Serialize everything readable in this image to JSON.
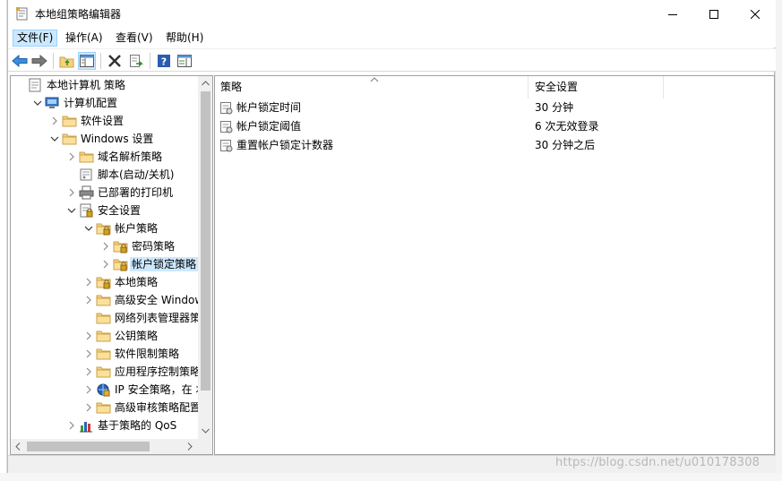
{
  "window": {
    "title": "本地组策略编辑器"
  },
  "menu": [
    {
      "label": "文件(F)"
    },
    {
      "label": "操作(A)"
    },
    {
      "label": "查看(V)"
    },
    {
      "label": "帮助(H)"
    }
  ],
  "tree": [
    {
      "label": "本地计算机 策略",
      "expander": "none",
      "icon": "policy-document-icon"
    },
    {
      "label": "计算机配置",
      "expander": "expanded",
      "icon": "computer-icon"
    },
    {
      "label": "软件设置",
      "expander": "collapsed",
      "icon": "folder-icon"
    },
    {
      "label": "Windows 设置",
      "expander": "expanded",
      "icon": "folder-icon"
    },
    {
      "label": "域名解析策略",
      "expander": "collapsed",
      "icon": "folder-icon"
    },
    {
      "label": "脚本(启动/关机)",
      "expander": "none",
      "icon": "script-icon"
    },
    {
      "label": "已部署的打印机",
      "expander": "collapsed",
      "icon": "printer-icon"
    },
    {
      "label": "安全设置",
      "expander": "expanded",
      "icon": "security-settings-icon"
    },
    {
      "label": "帐户策略",
      "expander": "expanded",
      "icon": "locked-folder-icon"
    },
    {
      "label": "密码策略",
      "expander": "collapsed",
      "icon": "locked-folder-icon"
    },
    {
      "label": "帐户锁定策略",
      "expander": "collapsed",
      "icon": "locked-folder-icon",
      "selected": true
    },
    {
      "label": "本地策略",
      "expander": "collapsed",
      "icon": "locked-folder-icon"
    },
    {
      "label": "高级安全 Windows",
      "expander": "collapsed",
      "icon": "folder-icon"
    },
    {
      "label": "网络列表管理器策略",
      "expander": "none",
      "icon": "folder-icon"
    },
    {
      "label": "公钥策略",
      "expander": "collapsed",
      "icon": "folder-icon"
    },
    {
      "label": "软件限制策略",
      "expander": "collapsed",
      "icon": "folder-icon"
    },
    {
      "label": "应用程序控制策略",
      "expander": "collapsed",
      "icon": "folder-icon"
    },
    {
      "label": "IP 安全策略，在 本",
      "expander": "collapsed",
      "icon": "ip-security-icon"
    },
    {
      "label": "高级审核策略配置",
      "expander": "collapsed",
      "icon": "folder-icon"
    },
    {
      "label": "基于策略的 QoS",
      "expander": "collapsed",
      "icon": "qos-chart-icon"
    }
  ],
  "list": {
    "columns": [
      "策略",
      "安全设置"
    ],
    "rows": [
      {
        "policy": "帐户锁定时间",
        "setting": "30 分钟"
      },
      {
        "policy": "帐户锁定阈值",
        "setting": "6 次无效登录"
      },
      {
        "policy": "重置帐户锁定计数器",
        "setting": "30 分钟之后"
      }
    ]
  },
  "watermark": "https://blog.csdn.net/u010178308",
  "colors": {
    "selection": "#cce8ff",
    "selection_border": "#99d1ff",
    "folder": "#f7d17a",
    "scroll_thumb": "#c2c2c2"
  }
}
